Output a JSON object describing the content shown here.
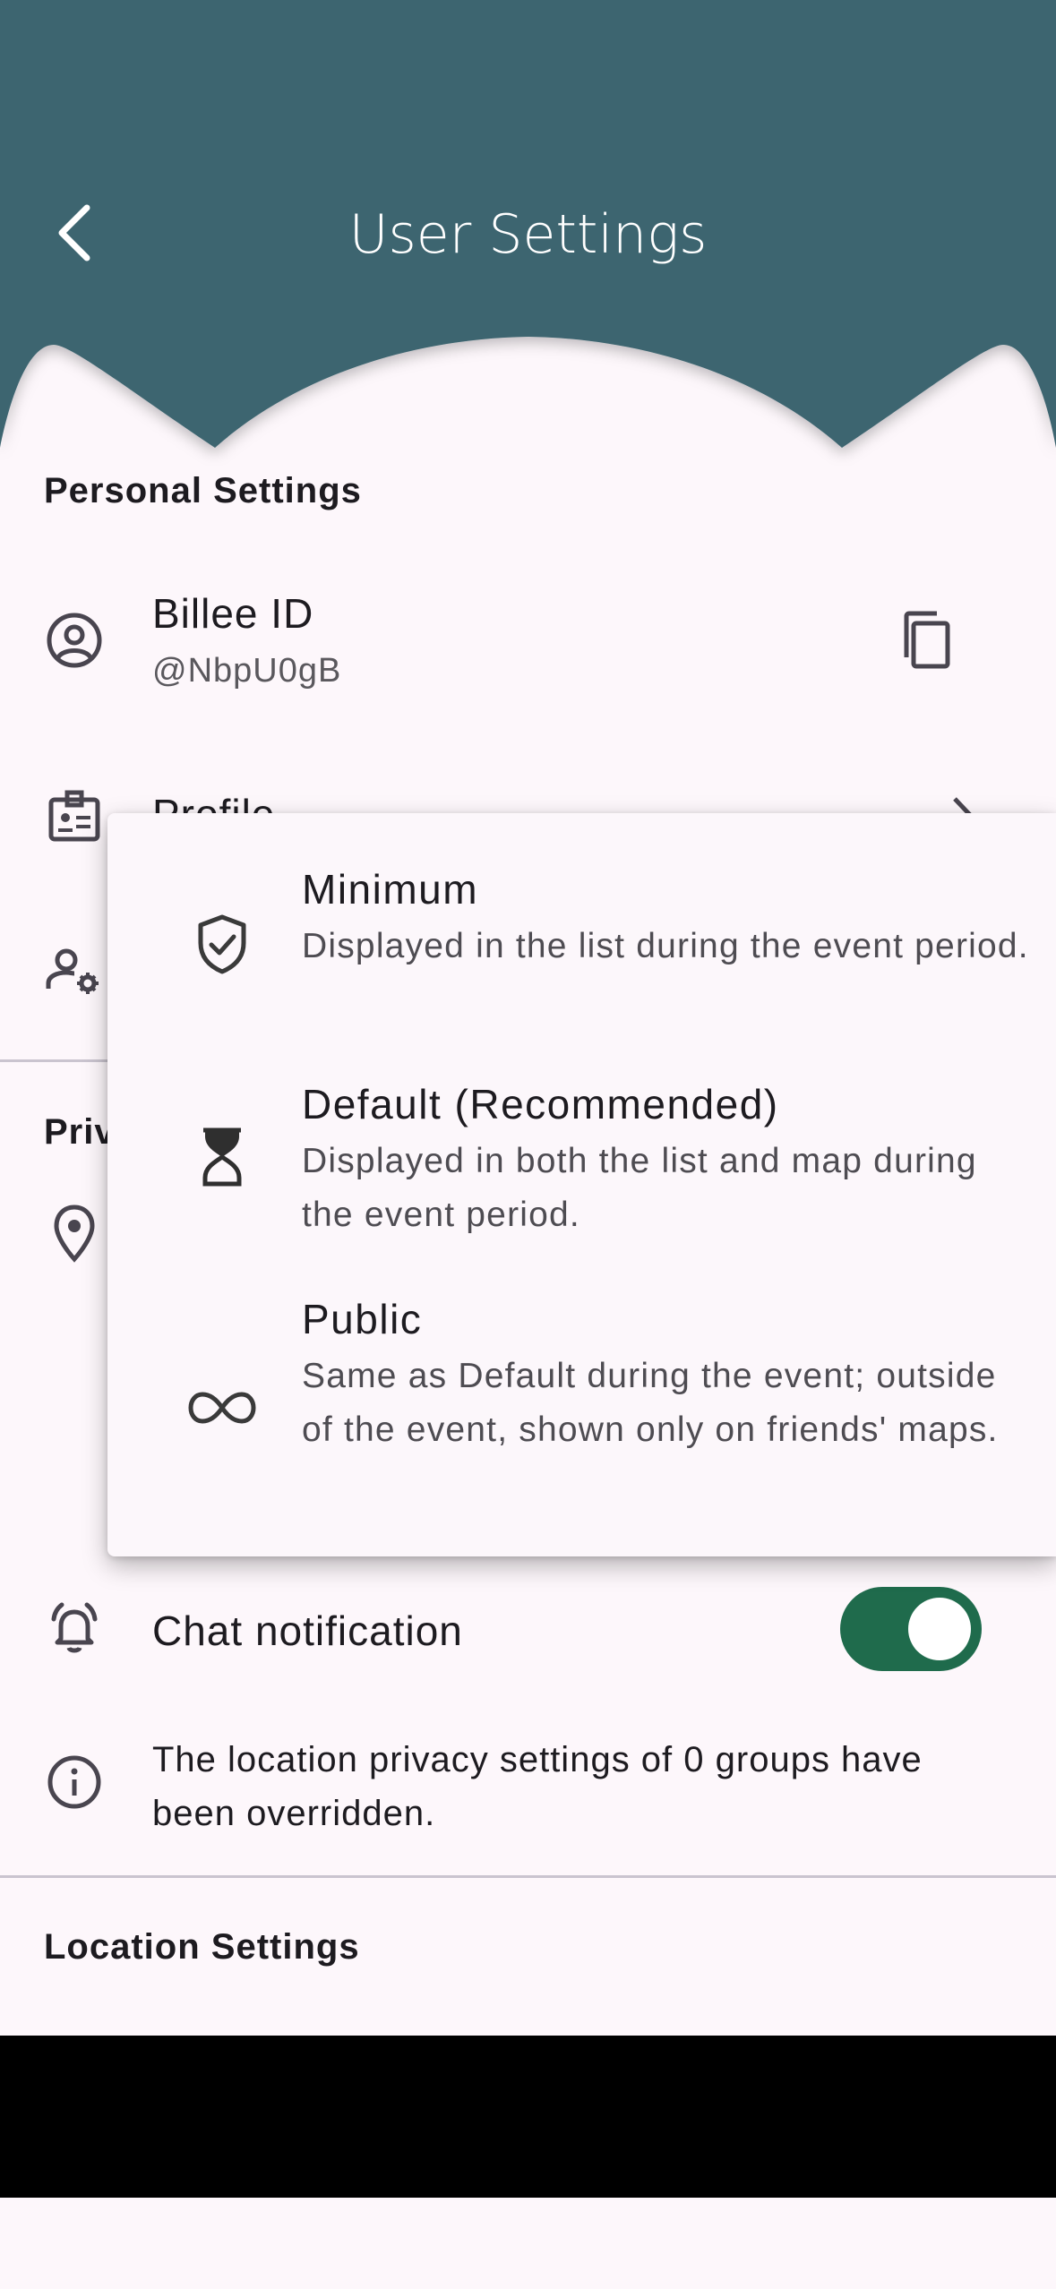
{
  "header": {
    "title": "User Settings",
    "back_icon": "chevron-left-icon",
    "color": "#3d6570"
  },
  "personal": {
    "section_title": "Personal Settings",
    "billee_id": {
      "label": "Billee ID",
      "value": "@NbpU0gB",
      "copy_icon": "copy-icon"
    },
    "profile": {
      "label": "Profile"
    }
  },
  "privacy": {
    "section_title_partial": "Priv"
  },
  "dropdown": {
    "options": [
      {
        "title": "Minimum",
        "description": "Displayed in the list during the event period.",
        "icon": "shield-check-icon"
      },
      {
        "title": "Default (Recommended)",
        "description": "Displayed in both the list and map during the event period.",
        "icon": "hourglass-icon"
      },
      {
        "title": "Public",
        "description": "Same as Default during the event; outside of the event, shown only on friends' maps.",
        "icon": "infinity-icon"
      }
    ]
  },
  "chat_notification": {
    "label": "Chat notification",
    "enabled": true,
    "toggle_color": "#1f6b4c"
  },
  "info": {
    "text": "The location privacy settings of 0 groups have been overridden."
  },
  "location": {
    "section_title": "Location Settings"
  }
}
